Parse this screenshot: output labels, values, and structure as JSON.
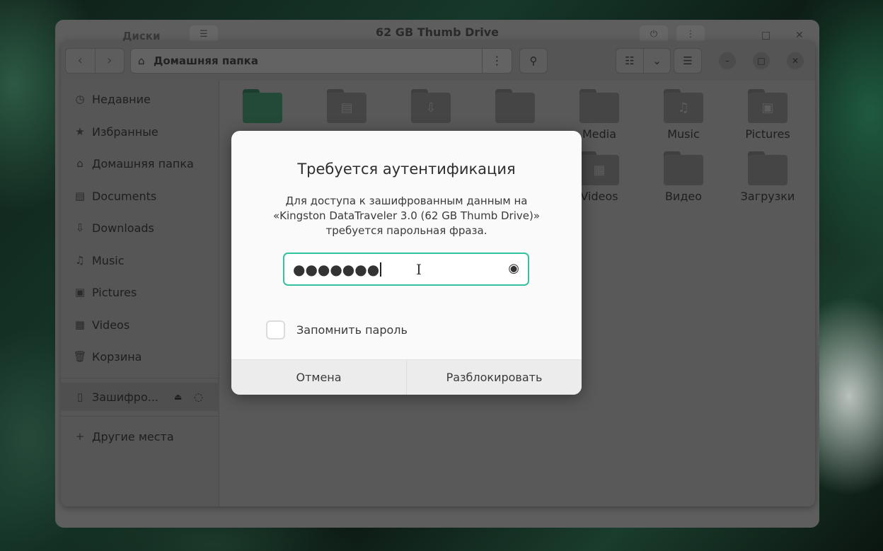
{
  "back_window": {
    "title": "62 GB Thumb Drive",
    "left_title": "Диски"
  },
  "files": {
    "pathbar": {
      "home_icon": "home-icon",
      "label": "Домашняя папка"
    },
    "sidebar": {
      "items": [
        {
          "icon": "clock-icon",
          "label": "Недавние"
        },
        {
          "icon": "star-icon",
          "label": "Избранные"
        },
        {
          "icon": "home-icon",
          "label": "Домашняя папка"
        },
        {
          "icon": "document-icon",
          "label": "Documents"
        },
        {
          "icon": "download-icon",
          "label": "Downloads"
        },
        {
          "icon": "music-icon",
          "label": "Music"
        },
        {
          "icon": "pictures-icon",
          "label": "Pictures"
        },
        {
          "icon": "video-icon",
          "label": "Videos"
        },
        {
          "icon": "trash-icon",
          "label": "Корзина"
        }
      ],
      "encrypted_device": {
        "icon": "usb-drive-icon",
        "label": "Зашифро..."
      },
      "other_places": {
        "icon": "plus-icon",
        "label": "Другие места"
      }
    },
    "folders": [
      {
        "label": "Media",
        "icon": "folder-icon"
      },
      {
        "label": "Music",
        "icon": "folder-music-icon"
      },
      {
        "label": "Pictures",
        "icon": "folder-pictures-icon"
      },
      {
        "label": "Videos",
        "icon": "folder-videos-icon"
      },
      {
        "label": "Видео",
        "icon": "folder-icon"
      },
      {
        "label": "Загрузки",
        "icon": "folder-icon"
      }
    ]
  },
  "dialog": {
    "title": "Требуется аутентификация",
    "message_line1": "Для доступа к зашифрованным данным на",
    "message_line2": "«Kingston DataTraveler 3.0 (62 GB Thumb Drive)»",
    "message_line3": "требуется парольная фраза.",
    "password_value": "●●●●●●●",
    "remember_label": "Запомнить пароль",
    "remember_checked": false,
    "cancel_label": "Отмена",
    "unlock_label": "Разблокировать",
    "accent_color": "#33c1a0"
  }
}
